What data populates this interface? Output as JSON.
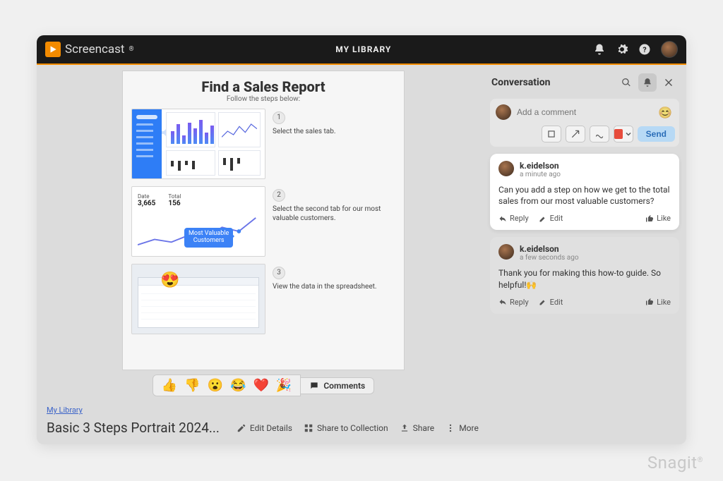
{
  "header": {
    "brand": "Screencast",
    "nav_center": "MY LIBRARY"
  },
  "doc": {
    "title": "Find a Sales Report",
    "subtitle": "Follow the steps below:",
    "steps": [
      {
        "num": "1",
        "text": "Select the sales tab."
      },
      {
        "num": "2",
        "text": "Select the second tab for our most valuable customers."
      },
      {
        "num": "3",
        "text": "View the data in the spreadsheet."
      }
    ],
    "callout": "Most Valuable\nCustomers",
    "metrics": {
      "a_label": "Date",
      "a_val": "3,665",
      "b_label": "Total",
      "b_val": "156"
    }
  },
  "reactions": {
    "emojis": [
      "👍",
      "👎",
      "😮",
      "😂",
      "❤️",
      "🎉"
    ],
    "comments_btn": "Comments"
  },
  "meta": {
    "breadcrumb": "My Library",
    "title": "Basic 3 Steps Portrait 2024...",
    "actions": {
      "edit": "Edit Details",
      "collection": "Share to Collection",
      "share": "Share",
      "more": "More"
    }
  },
  "conv": {
    "title": "Conversation",
    "placeholder": "Add a comment",
    "send": "Send",
    "comments": [
      {
        "user": "k.eidelson",
        "time": "a minute ago",
        "body": "Can you add a step on how we get to the total sales from our most valuable customers?",
        "reply": "Reply",
        "edit": "Edit",
        "like": "Like"
      },
      {
        "user": "k.eidelson",
        "time": "a few seconds ago",
        "body": "Thank you for making this how-to guide. So helpful!🙌",
        "reply": "Reply",
        "edit": "Edit",
        "like": "Like"
      }
    ]
  },
  "watermark": "Snagit"
}
